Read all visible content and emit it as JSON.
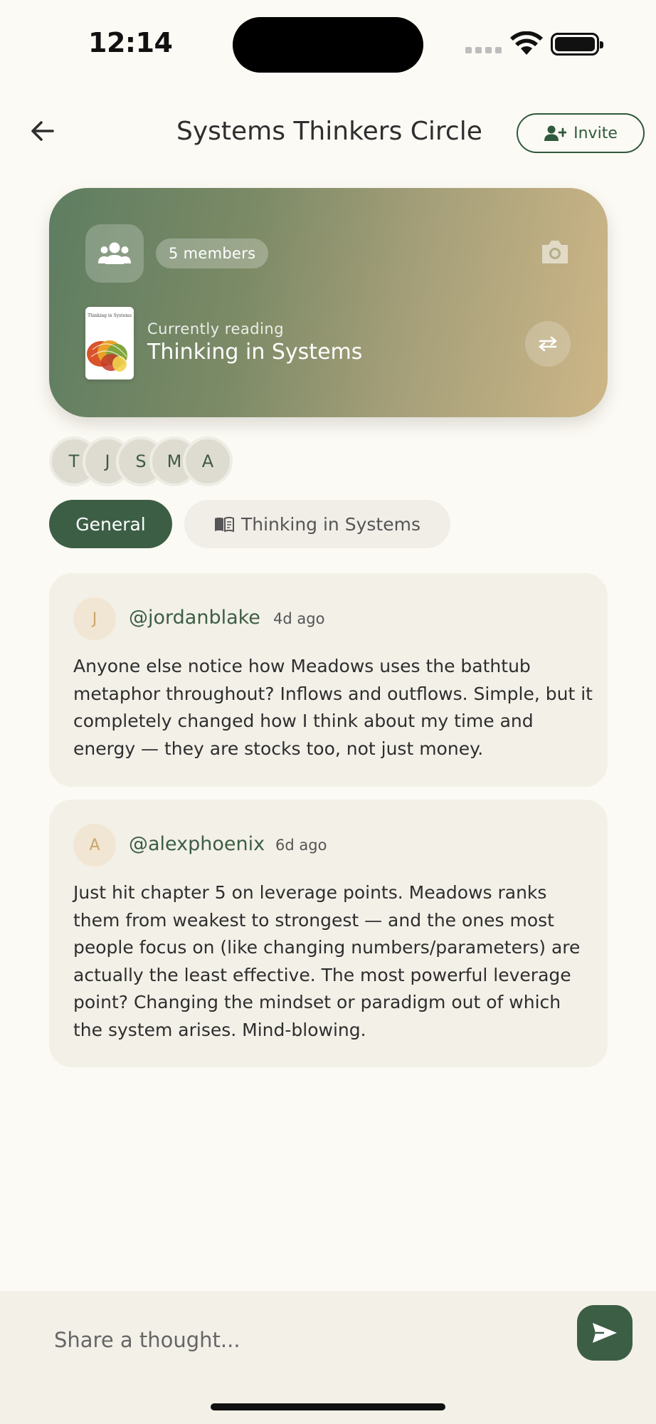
{
  "status_bar": {
    "time": "12:14"
  },
  "header": {
    "title": "Systems Thinkers Circle",
    "invite_label": "Invite",
    "back_icon": "arrow-left-icon",
    "invite_icon": "user-plus-icon"
  },
  "hero": {
    "members_label": "5 members",
    "currently_reading_label": "Currently reading",
    "book_title": "Thinking in Systems",
    "cover_title": "Thinking in Systems",
    "group_icon": "users-icon",
    "camera_icon": "camera-icon",
    "swap_icon": "swap-arrows-icon"
  },
  "members": [
    {
      "initial": "T"
    },
    {
      "initial": "J"
    },
    {
      "initial": "S"
    },
    {
      "initial": "M"
    },
    {
      "initial": "A"
    }
  ],
  "tabs": [
    {
      "label": "General",
      "active": true
    },
    {
      "label": "Thinking in Systems",
      "active": false,
      "icon": "book-icon"
    }
  ],
  "posts": [
    {
      "initial": "J",
      "username": "@jordanblake",
      "time": "4d ago",
      "body": "Anyone else notice how Meadows uses the bathtub metaphor throughout? Inflows and outflows. Simple, but it completely changed how I think about my time and energy — they are stocks too, not just money."
    },
    {
      "initial": "A",
      "username": "@alexphoenix",
      "time": "6d ago",
      "body": "Just hit chapter 5 on leverage points. Meadows ranks them from weakest to strongest — and the ones most people focus on (like changing numbers/parameters) are actually the least effective. The most powerful leverage point? Changing the mindset or paradigm out of which the system arises. Mind-blowing."
    }
  ],
  "composer": {
    "placeholder": "Share a thought...",
    "send_icon": "send-icon"
  },
  "colors": {
    "brand_green": "#3C5E45",
    "background": "#FCFAF4",
    "card": "#F3F0E8",
    "accent_tan": "#CBA46A"
  }
}
